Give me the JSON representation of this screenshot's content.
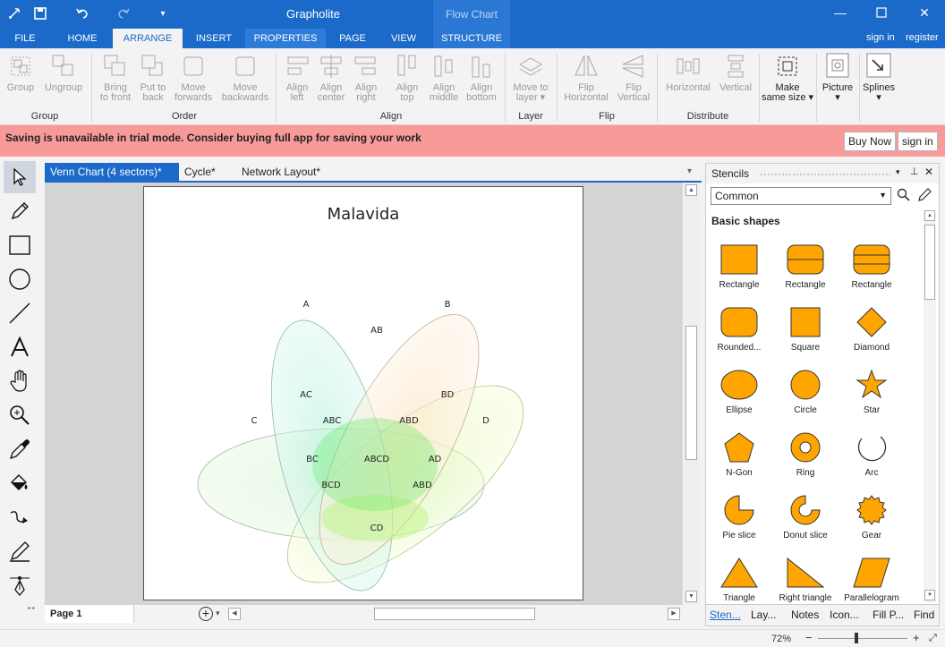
{
  "app": {
    "title": "Grapholite",
    "context_title": "Flow Chart"
  },
  "tabs": [
    {
      "label": "FILE"
    },
    {
      "label": "HOME"
    },
    {
      "label": "ARRANGE"
    },
    {
      "label": "INSERT"
    },
    {
      "label": "PROPERTIES"
    },
    {
      "label": "PAGE"
    },
    {
      "label": "VIEW"
    },
    {
      "label": "STRUCTURE"
    }
  ],
  "account": {
    "sign_in": "sign in",
    "register": "register"
  },
  "ribbon": {
    "buttons": [
      {
        "l1": "Group",
        "l2": ""
      },
      {
        "l1": "Ungroup",
        "l2": ""
      },
      {
        "l1": "Bring",
        "l2": "to front"
      },
      {
        "l1": "Put to",
        "l2": "back"
      },
      {
        "l1": "Move",
        "l2": "forwards"
      },
      {
        "l1": "Move",
        "l2": "backwards"
      },
      {
        "l1": "Align",
        "l2": "left"
      },
      {
        "l1": "Align",
        "l2": "center"
      },
      {
        "l1": "Align",
        "l2": "right"
      },
      {
        "l1": "Align",
        "l2": "top"
      },
      {
        "l1": "Align",
        "l2": "middle"
      },
      {
        "l1": "Align",
        "l2": "bottom"
      },
      {
        "l1": "Move to",
        "l2": "layer ▾"
      },
      {
        "l1": "Flip",
        "l2": "Horizontal"
      },
      {
        "l1": "Flip",
        "l2": "Vertical"
      },
      {
        "l1": "Horizontal",
        "l2": ""
      },
      {
        "l1": "Vertical",
        "l2": ""
      },
      {
        "l1": "Make",
        "l2": "same size ▾"
      },
      {
        "l1": "Picture",
        "l2": "▾"
      },
      {
        "l1": "Splines",
        "l2": "▾"
      }
    ],
    "groups": [
      "Group",
      "Order",
      "Align",
      "Layer",
      "Flip",
      "Distribute"
    ]
  },
  "banner": {
    "message": "Saving is unavailable in trial mode. Consider buying full app for saving your work",
    "buy_now": "Buy Now",
    "sign_in": "sign in"
  },
  "document_tabs": [
    "Venn Chart (4 sectors)*",
    "Cycle*",
    "Network Layout*"
  ],
  "doc_tab_close": "×",
  "diagram": {
    "title": "Malavida",
    "regions": [
      "A",
      "B",
      "AB",
      "AC",
      "BD",
      "C",
      "ABC",
      "ABD",
      "D",
      "BC",
      "ABCD",
      "AD",
      "BCD",
      "ABD",
      "CD"
    ]
  },
  "page_bar": {
    "page_label": "Page 1"
  },
  "stencils": {
    "panel_title": "Stencils",
    "category": "Common",
    "section": "Basic shapes",
    "fill": "#FFA500",
    "items": [
      "Rectangle",
      "Rectangle",
      "Rectangle",
      "Rounded...",
      "Square",
      "Diamond",
      "Ellipse",
      "Circle",
      "Star",
      "N-Gon",
      "Ring",
      "Arc",
      "Pie slice",
      "Donut slice",
      "Gear",
      "Triangle",
      "Right triangle",
      "Parallelogram"
    ],
    "tabs": [
      "Sten...",
      "Lay...",
      "Notes",
      "Icon...",
      "Fill P...",
      "Find"
    ]
  },
  "status": {
    "zoom": "72%"
  },
  "colors": {
    "accent": "#1b6ac9",
    "banner": "#f99a9a"
  }
}
